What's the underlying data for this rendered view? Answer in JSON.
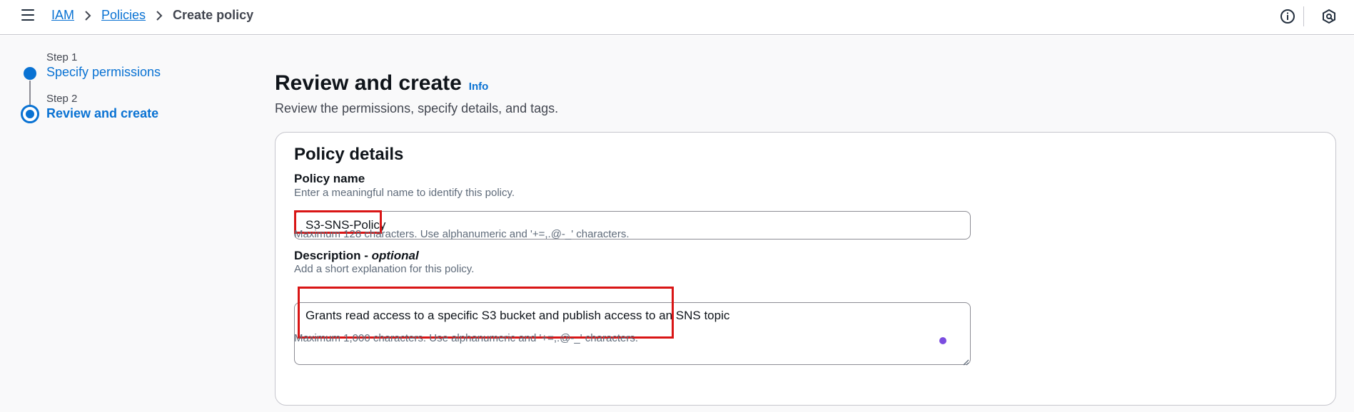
{
  "breadcrumb": {
    "items": [
      "IAM",
      "Policies"
    ],
    "current": "Create policy"
  },
  "steps": [
    {
      "label": "Step 1",
      "title": "Specify permissions"
    },
    {
      "label": "Step 2",
      "title": "Review and create"
    }
  ],
  "page": {
    "title": "Review and create",
    "info_link": "Info",
    "description": "Review the permissions, specify details, and tags."
  },
  "policy_details": {
    "title": "Policy details",
    "name_label": "Policy name",
    "name_hint": "Enter a meaningful name to identify this policy.",
    "name_value": "S3-SNS-Policy",
    "name_constraint": "Maximum 128 characters. Use alphanumeric and '+=,.@-_' characters.",
    "description_label": "Description - ",
    "description_optional": "optional",
    "description_hint": "Add a short explanation for this policy.",
    "description_value": "Grants read access to a specific S3 bucket and publish access to an SNS topic",
    "description_constraint": "Maximum 1,000 characters. Use alphanumeric and '+=,.@-_' characters."
  },
  "icons": {
    "menu": "menu-icon",
    "info": "info-circle-icon",
    "settings": "settings-hexagon-icon",
    "chevron": "chevron-right-icon"
  },
  "colors": {
    "link": "#0972d3",
    "highlight": "#d91515",
    "assistant_dot": "#7b4ce0"
  }
}
